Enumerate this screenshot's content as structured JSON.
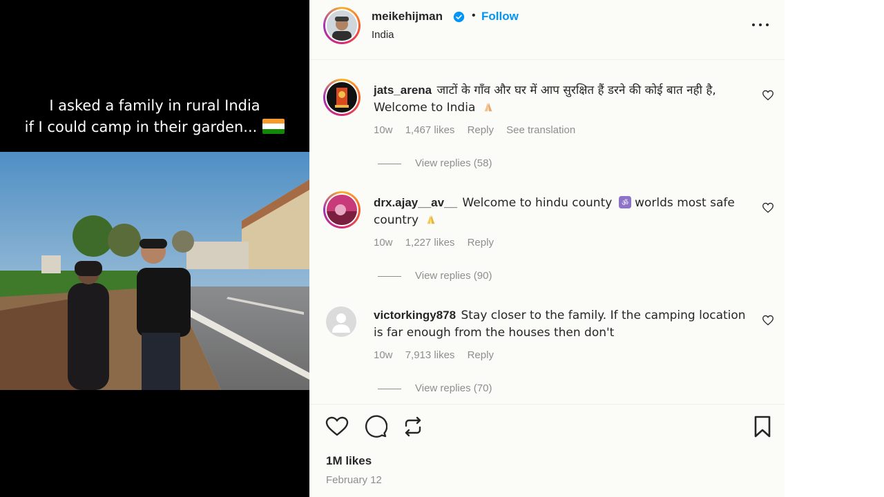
{
  "media": {
    "caption_line1": "I asked a family in rural India",
    "caption_line2": "if I could camp in their garden..."
  },
  "header": {
    "username": "meikehijman",
    "follow_label": "Follow",
    "location": "India",
    "separator": "•"
  },
  "comments": [
    {
      "username": "jats_arena",
      "text": "जाटों के गाँव और घर में आप सुरक्षित हैं डरने की कोई बात नही है, Welcome to India",
      "age": "10w",
      "likes": "1,467 likes",
      "reply_label": "Reply",
      "translate_label": "See translation",
      "view_replies": "View replies (58)"
    },
    {
      "username": "drx.ajay__av__",
      "text": "Welcome to hindu county",
      "text_after": "worlds most safe country",
      "age": "10w",
      "likes": "1,227 likes",
      "reply_label": "Reply",
      "view_replies": "View replies (90)"
    },
    {
      "username": "victorkingy878",
      "text": "Stay closer to the family. If the camping location is far enough from the houses then don't",
      "age": "10w",
      "likes": "7,913 likes",
      "reply_label": "Reply",
      "view_replies": "View replies (70)"
    }
  ],
  "footer": {
    "likes": "1M likes",
    "date": "February 12"
  },
  "icons": {
    "like": "heart-icon",
    "comment": "comment-icon",
    "share": "repost-icon",
    "save": "bookmark-icon",
    "more": "more-options-icon",
    "verified": "verified-badge-icon"
  },
  "colors": {
    "link": "#0095f6",
    "muted": "#8e8e8e",
    "text": "#262626"
  }
}
